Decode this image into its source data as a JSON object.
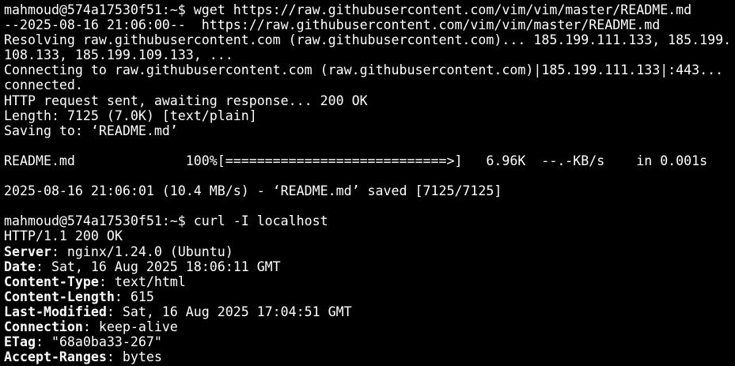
{
  "terminal": {
    "background": "#000000",
    "foreground": "#ffffff",
    "lines": [
      {
        "text": "mahmoud@574a17530f51:~$ wget https://raw.githubusercontent.com/vim/vim/master/README.md"
      },
      {
        "text": "--2025-08-16 21:06:00--  https://raw.githubusercontent.com/vim/vim/master/README.md"
      },
      {
        "text": "Resolving raw.githubusercontent.com (raw.githubusercontent.com)... 185.199.111.133, 185.199."
      },
      {
        "text": "108.133, 185.199.109.133, ..."
      },
      {
        "text": "Connecting to raw.githubusercontent.com (raw.githubusercontent.com)|185.199.111.133|:443..."
      },
      {
        "text": "connected."
      },
      {
        "text": "HTTP request sent, awaiting response... 200 OK"
      },
      {
        "text": "Length: 7125 (7.0K) [text/plain]"
      },
      {
        "text": "Saving to: ‘README.md’"
      },
      {
        "text": ""
      },
      {
        "text": "README.md              100%[============================>]   6.96K  --.-KB/s    in 0.001s"
      },
      {
        "text": ""
      },
      {
        "text": "2025-08-16 21:06:01 (10.4 MB/s) - ‘README.md’ saved [7125/7125]"
      },
      {
        "text": ""
      },
      {
        "text": "mahmoud@574a17530f51:~$ curl -I localhost"
      },
      {
        "text": "HTTP/1.1 200 OK"
      }
    ],
    "headers": [
      {
        "key": "Server",
        "value": ": nginx/1.24.0 (Ubuntu)"
      },
      {
        "key": "Date",
        "value": ": Sat, 16 Aug 2025 18:06:11 GMT"
      },
      {
        "key": "Content-Type",
        "value": ": text/html"
      },
      {
        "key": "Content-Length",
        "value": ": 615"
      },
      {
        "key": "Last-Modified",
        "value": ": Sat, 16 Aug 2025 17:04:51 GMT"
      },
      {
        "key": "Connection",
        "value": ": keep-alive"
      },
      {
        "key": "ETag",
        "value": ": \"68a0ba33-267\""
      },
      {
        "key": "Accept-Ranges",
        "value": ": bytes"
      }
    ]
  }
}
